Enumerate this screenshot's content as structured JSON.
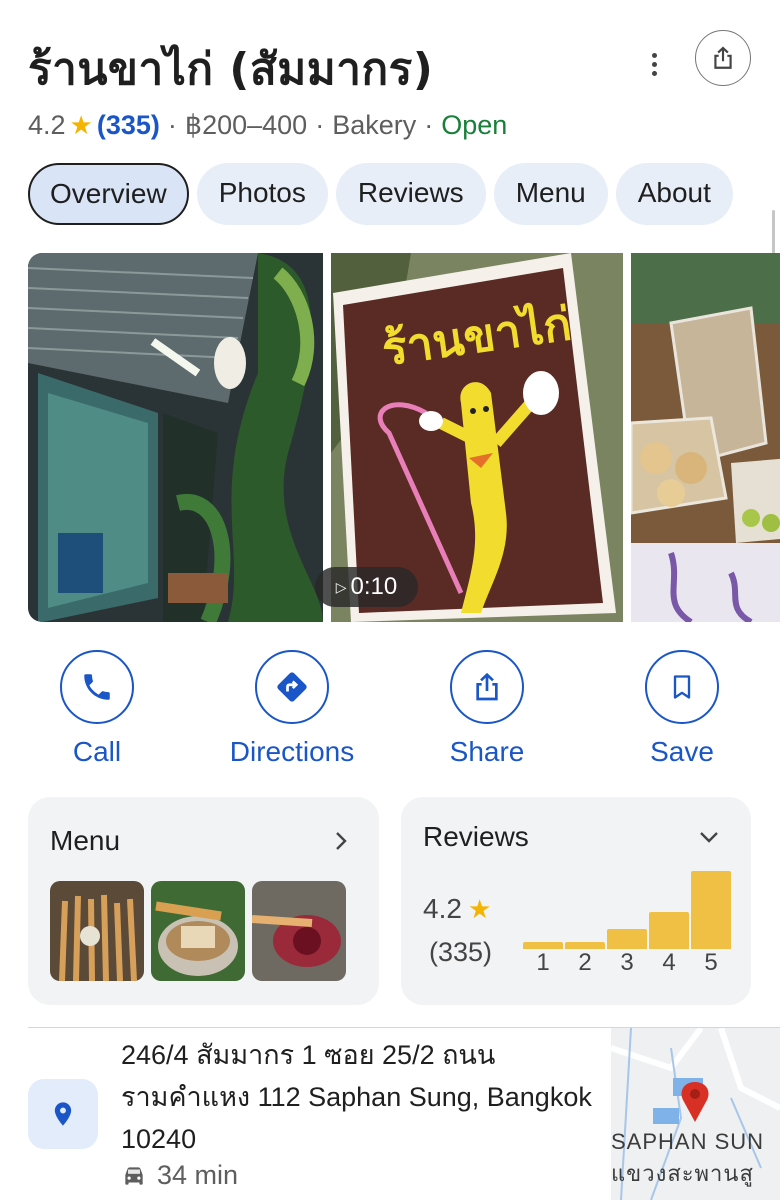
{
  "place": {
    "title": "ร้านขาไก่ (สัมมากร)",
    "rating": "4.2",
    "review_count": "(335)",
    "price": "฿200–400",
    "category": "Bakery",
    "status": "Open"
  },
  "tabs": [
    {
      "label": "Overview"
    },
    {
      "label": "Photos"
    },
    {
      "label": "Reviews"
    },
    {
      "label": "Menu"
    },
    {
      "label": "About"
    }
  ],
  "photos": {
    "sign_text": "ร้านขาไก่",
    "video_duration": "0:10"
  },
  "actions": [
    {
      "label": "Call",
      "icon": "phone-icon"
    },
    {
      "label": "Directions",
      "icon": "directions-icon"
    },
    {
      "label": "Share",
      "icon": "share-icon"
    },
    {
      "label": "Save",
      "icon": "bookmark-icon"
    }
  ],
  "menu_card": {
    "title": "Menu"
  },
  "reviews_card": {
    "title": "Reviews",
    "rating": "4.2",
    "count": "(335)"
  },
  "chart_data": {
    "type": "bar",
    "categories": [
      "1",
      "2",
      "3",
      "4",
      "5"
    ],
    "values": [
      0.09,
      0.09,
      0.26,
      0.48,
      1.0
    ],
    "title": "",
    "xlabel": "",
    "ylabel": ""
  },
  "address": {
    "text": "246/4 สัมมากร 1 ซอย 25/2 ถนนรามคำแหง 112 Saphan Sung, Bangkok 10240",
    "drive_time": "34 min"
  },
  "map": {
    "label_en": "SAPHAN SUN",
    "label_th": "แขวงสะพานสู"
  },
  "colors": {
    "accent": "#1a56c8",
    "star": "#f5b400",
    "open": "#188038",
    "bar": "#f0c044"
  }
}
